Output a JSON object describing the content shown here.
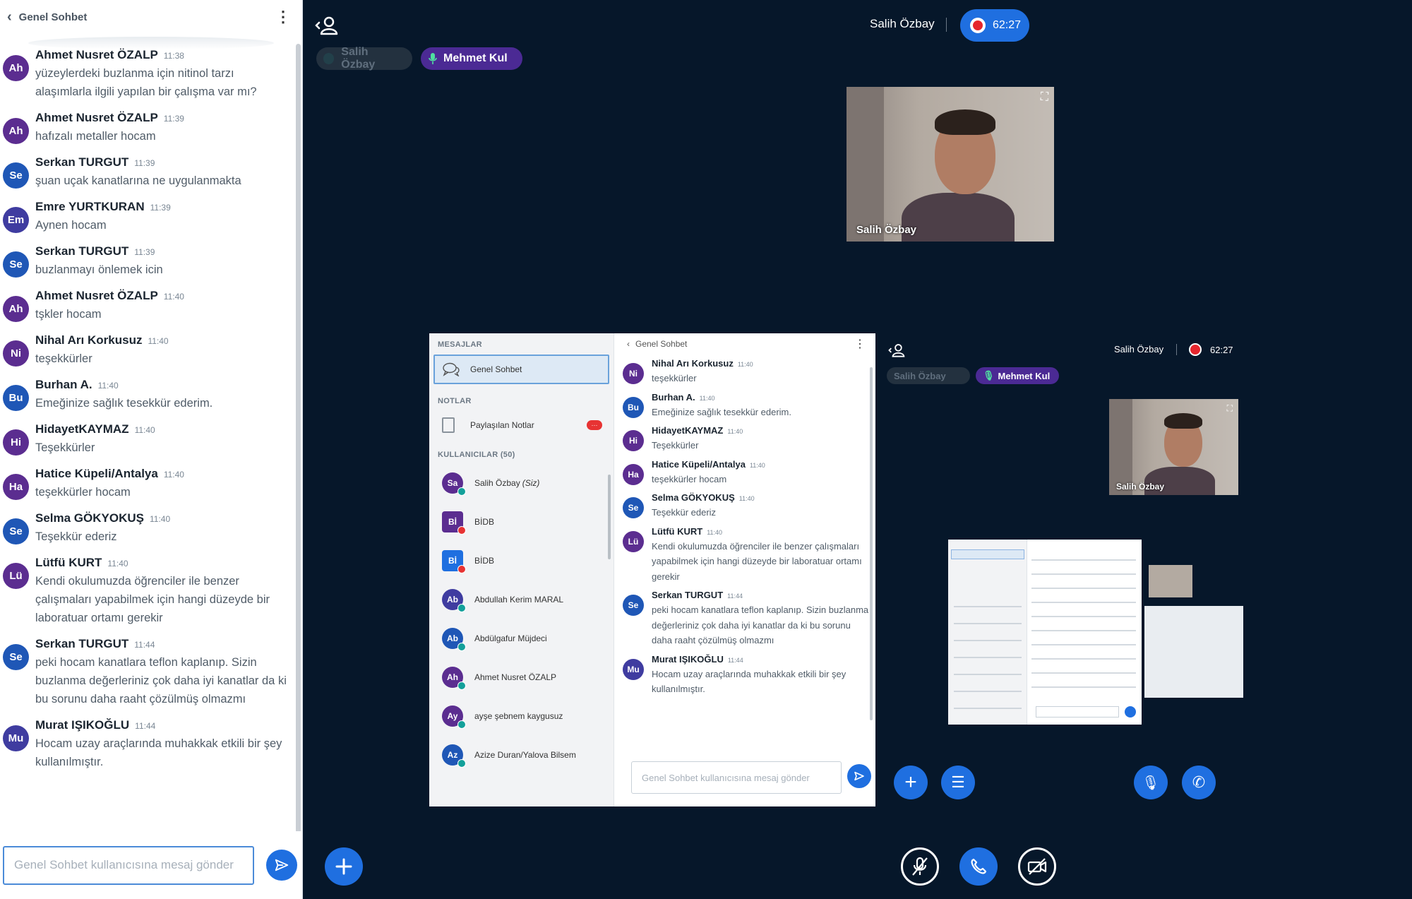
{
  "chat": {
    "title": "Genel Sohbet",
    "input_placeholder": "Genel Sohbet kullanıcısına mesaj gönder",
    "messages": [
      {
        "initials": "Ah",
        "name": "Ahmet Nusret ÖZALP",
        "time": "11:38",
        "text": "yüzeylerdeki buzlanma için nitinol tarzı alaşımlarla ilgili yapılan bir çalışma var mı?",
        "color": "#5b2d90"
      },
      {
        "initials": "Ah",
        "name": "Ahmet Nusret ÖZALP",
        "time": "11:39",
        "text": "hafızalı metaller hocam",
        "color": "#5b2d90"
      },
      {
        "initials": "Se",
        "name": "Serkan TURGUT",
        "time": "11:39",
        "text": "şuan uçak kanatlarına ne uygulanmakta",
        "color": "#1f57b6"
      },
      {
        "initials": "Em",
        "name": "Emre YURTKURAN",
        "time": "11:39",
        "text": "Aynen hocam",
        "color": "#3f3ca0"
      },
      {
        "initials": "Se",
        "name": "Serkan TURGUT",
        "time": "11:39",
        "text": "buzlanmayı önlemek icin",
        "color": "#1f57b6"
      },
      {
        "initials": "Ah",
        "name": "Ahmet Nusret ÖZALP",
        "time": "11:40",
        "text": "tşkler hocam",
        "color": "#5b2d90"
      },
      {
        "initials": "Ni",
        "name": "Nihal Arı Korkusuz",
        "time": "11:40",
        "text": "teşekkürler",
        "color": "#5b2d90"
      },
      {
        "initials": "Bu",
        "name": "Burhan A.",
        "time": "11:40",
        "text": "Emeğinize sağlık tesekkür ederim.",
        "color": "#1f57b6"
      },
      {
        "initials": "Hi",
        "name": "HidayetKAYMAZ",
        "time": "11:40",
        "text": "Teşekkürler",
        "color": "#5b2d90"
      },
      {
        "initials": "Ha",
        "name": "Hatice Küpeli/Antalya",
        "time": "11:40",
        "text": "teşekkürler hocam",
        "color": "#5b2d90"
      },
      {
        "initials": "Se",
        "name": "Selma GÖKYOKUŞ",
        "time": "11:40",
        "text": "Teşekkür ederiz",
        "color": "#1f57b6"
      },
      {
        "initials": "Lü",
        "name": "Lütfü KURT",
        "time": "11:40",
        "text": "Kendi okulumuzda öğrenciler ile benzer çalışmaları yapabilmek için hangi düzeyde bir laboratuar ortamı gerekir",
        "color": "#5b2d90"
      },
      {
        "initials": "Se",
        "name": "Serkan TURGUT",
        "time": "11:44",
        "text": "peki hocam kanatlara teflon kaplanıp. Sizin buzlanma değerleriniz çok daha iyi kanatlar da ki bu sorunu daha raaht çözülmüş olmazmı",
        "color": "#1f57b6"
      },
      {
        "initials": "Mu",
        "name": "Murat IŞIKOĞLU",
        "time": "11:44",
        "text": "Hocam uzay araçlarında muhakkak etkili bir şey kullanılmıştır.",
        "color": "#3f3ca0"
      }
    ]
  },
  "topbar": {
    "presenter": "Salih Özbay",
    "recording_time": "62:27",
    "talkers": [
      "Salih Özbay",
      "Mehmet Kul"
    ]
  },
  "webcam": {
    "label": "Salih Özbay"
  },
  "screenshare": {
    "messages_heading": "MESAJLAR",
    "public_chat": "Genel Sohbet",
    "notes_heading": "NOTLAR",
    "shared_notes": "Paylaşılan Notlar",
    "notes_badge": "···",
    "users_heading": "KULLANICILAR (50)",
    "users": [
      {
        "initials": "Sa",
        "name": "Salih Özbay",
        "you": "(Siz)",
        "color": "#5b2d90",
        "square": false,
        "status": "green"
      },
      {
        "initials": "Bİ",
        "name": "BİDB",
        "you": "",
        "color": "#5b2d90",
        "square": true,
        "status": "red"
      },
      {
        "initials": "Bİ",
        "name": "BİDB",
        "you": "",
        "color": "#1f6fe0",
        "square": true,
        "status": "red"
      },
      {
        "initials": "Ab",
        "name": "Abdullah Kerim MARAL",
        "you": "",
        "color": "#3f3ca0",
        "square": false,
        "status": "green"
      },
      {
        "initials": "Ab",
        "name": "Abdülgafur Müjdeci",
        "you": "",
        "color": "#1f57b6",
        "square": false,
        "status": "green"
      },
      {
        "initials": "Ah",
        "name": "Ahmet Nusret ÖZALP",
        "you": "",
        "color": "#5b2d90",
        "square": false,
        "status": "green"
      },
      {
        "initials": "Ay",
        "name": "ayşe şebnem kaygusuz",
        "you": "",
        "color": "#5b2d90",
        "square": false,
        "status": "green"
      },
      {
        "initials": "Az",
        "name": "Azize Duran/Yalova Bilsem",
        "you": "",
        "color": "#1f57b6",
        "square": false,
        "status": "green"
      }
    ],
    "chat_title": "Genel Sohbet",
    "input_placeholder": "Genel Sohbet kullanıcısına mesaj gönder",
    "messages": [
      {
        "initials": "Ni",
        "name": "Nihal Arı Korkusuz",
        "time": "11:40",
        "text": "teşekkürler",
        "color": "#5b2d90"
      },
      {
        "initials": "Bu",
        "name": "Burhan A.",
        "time": "11:40",
        "text": "Emeğinize sağlık tesekkür ederim.",
        "color": "#1f57b6"
      },
      {
        "initials": "Hi",
        "name": "HidayetKAYMAZ",
        "time": "11:40",
        "text": "Teşekkürler",
        "color": "#5b2d90"
      },
      {
        "initials": "Ha",
        "name": "Hatice Küpeli/Antalya",
        "time": "11:40",
        "text": "teşekkürler hocam",
        "color": "#5b2d90"
      },
      {
        "initials": "Se",
        "name": "Selma GÖKYOKUŞ",
        "time": "11:40",
        "text": "Teşekkür ederiz",
        "color": "#1f57b6"
      },
      {
        "initials": "Lü",
        "name": "Lütfü KURT",
        "time": "11:40",
        "text": "Kendi okulumuzda öğrenciler ile benzer çalışmaları yapabilmek için hangi düzeyde bir laboratuar ortamı gerekir",
        "color": "#5b2d90"
      },
      {
        "initials": "Se",
        "name": "Serkan TURGUT",
        "time": "11:44",
        "text": "peki hocam kanatlara teflon kaplanıp. Sizin buzlanma değerleriniz çok daha iyi kanatlar da ki bu sorunu daha raaht çözülmüş olmazmı",
        "color": "#1f57b6"
      },
      {
        "initials": "Mu",
        "name": "Murat IŞIKOĞLU",
        "time": "11:44",
        "text": "Hocam uzay araçlarında muhakkak etkili bir şey kullanılmıştır.",
        "color": "#3f3ca0"
      }
    ],
    "nested": {
      "presenter": "Salih Özbay",
      "recording_time": "62:27",
      "talkers": [
        "Salih Özbay",
        "Mehmet Kul"
      ],
      "webcam_label": "Salih Özbay"
    }
  },
  "colors": {
    "accent": "#1f6fe0",
    "background": "#06172a",
    "talking": "#4b2a94",
    "recording": "#e5262d"
  },
  "icons": [
    "back-icon",
    "kebab-icon",
    "send-icon",
    "users-icon",
    "record-icon",
    "mic-icon",
    "expand-icon",
    "plus-icon",
    "mic-muted-icon",
    "phone-icon",
    "camera-off-icon",
    "list-icon",
    "screen-icon",
    "video-icon"
  ]
}
